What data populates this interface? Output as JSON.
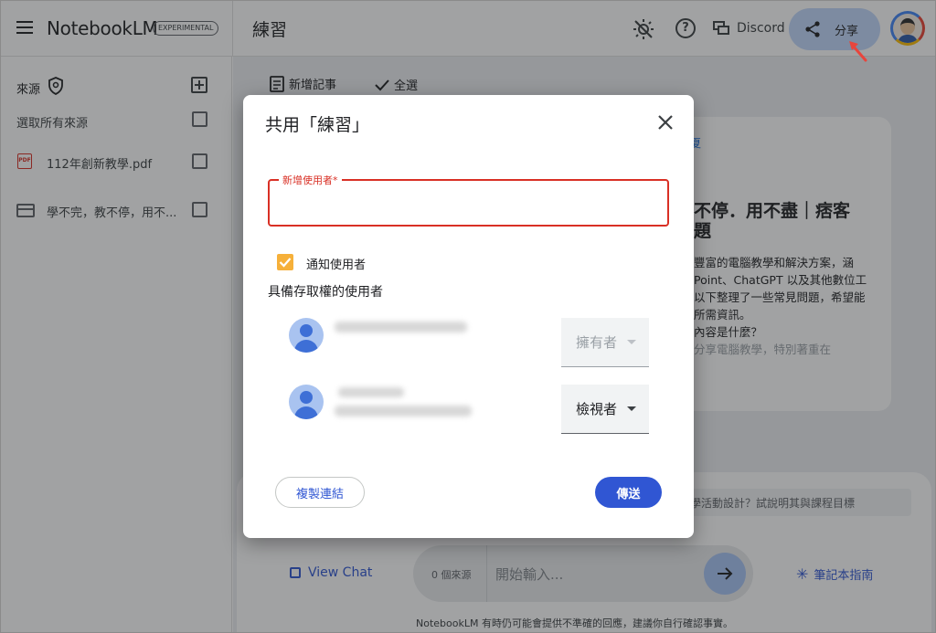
{
  "app": {
    "name": "NotebookLM",
    "badge": "EXPERIMENTAL"
  },
  "header": {
    "notebook_title": "練習",
    "discord_label": "Discord",
    "share_label": "分享"
  },
  "sidebar": {
    "sources_label": "來源",
    "select_all_label": "選取所有來源",
    "items": [
      {
        "icon": "pdf-icon",
        "icon_text": "PDF",
        "label": "112年創新教學.pdf"
      },
      {
        "icon": "web-page-icon",
        "label": "學不完，教不停，用不..."
      }
    ]
  },
  "toolbar": {
    "add_note_label": "新增記事",
    "select_all_label": "全選"
  },
  "background_card": {
    "link_fragment": "夏",
    "title_line1": "不停．用不盡｜痞客",
    "title_line2": "題",
    "lines": [
      "豐富的電腦教學和解決方案，涵",
      "Point、ChatGPT 以及其他數位工",
      "以下整理了一些常見問題，希望能",
      "所需資訊。",
      "內容是什麼？",
      "分享電腦教學，特別著重在"
    ]
  },
  "suggestion_text": "學活動設計？試說明其與課程目標",
  "chat": {
    "view_chat_label": "View Chat",
    "source_count": "0 個來源",
    "input_placeholder": "開始輸入...",
    "guide_label": "筆記本指南",
    "disclaimer": "NotebookLM 有時仍可能會提供不準確的回應，建議你自行確認事實。"
  },
  "dialog": {
    "title": "共用「練習」",
    "add_user_label": "新增使用者",
    "add_user_required": "*",
    "add_user_value": "",
    "notify_label": "通知使用者",
    "notify_checked": true,
    "access_heading": "具備存取權的使用者",
    "users": [
      {
        "role": "擁有者"
      },
      {
        "role": "檢視者"
      }
    ],
    "copy_link_label": "複製連結",
    "send_label": "傳送"
  },
  "colors": {
    "accent": "#3056d3",
    "error": "#d93025",
    "checkbox": "#f6b03a",
    "scrim": "rgba(32,33,36,0.42)",
    "arrow": "#e8453c"
  }
}
